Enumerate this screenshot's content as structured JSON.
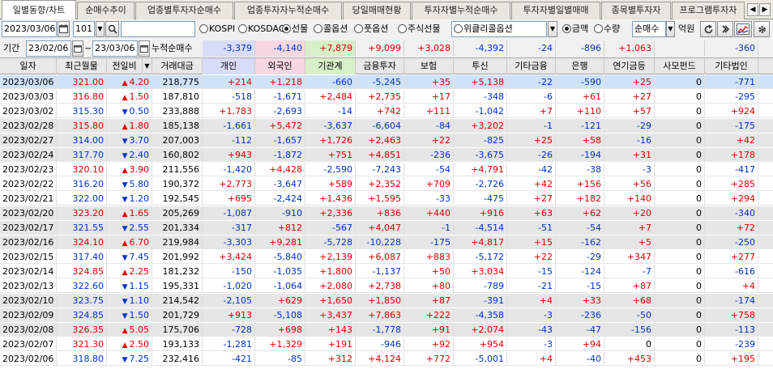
{
  "tabs": [
    "일별동향/차트",
    "순매수추이",
    "업종별투자자순매수",
    "업종투자자누적순매수",
    "당일매매현황",
    "투자자별누적순매수",
    "투자자별일별매매",
    "종목별투자자",
    "프로그램투자자"
  ],
  "nav": {
    "prev": "◀",
    "next": "▶"
  },
  "toolbar": {
    "date": "2023/03/06",
    "code": "101",
    "market_options": [
      "KOSPI",
      "KOSDAQ",
      "선물",
      "콜옵션",
      "풋옵션",
      "주식선물",
      "위클리콜옵션"
    ],
    "market_selected": "선물",
    "amount_options": [
      "금액",
      "수량"
    ],
    "amount_selected": "금액",
    "trade_type": "순매수",
    "unit": "억원"
  },
  "period": {
    "label": "기간",
    "from": "23/02/06",
    "tilde": "~",
    "to": "23/03/06",
    "cumulative_label": "누적순매수",
    "sums": [
      "-3,379",
      "-4,140",
      "+7,879",
      "+9,099",
      "+3,028",
      "-4,392",
      "-24",
      "-896",
      "+1,063",
      "",
      "-360"
    ]
  },
  "columns": [
    "일자",
    "최근월물",
    "전일비",
    "거래대금",
    "개인",
    "외국인",
    "기관계",
    "금융투자",
    "보험",
    "투신",
    "기타금융",
    "은행",
    "연기금등",
    "사모펀드",
    "기타법인"
  ],
  "rows": [
    [
      "2023/03/06",
      "321.00",
      "up",
      "4.20",
      "218,775",
      "+214",
      "+1,218",
      "-660",
      "-5,245",
      "+35",
      "+5,138",
      "-22",
      "-590",
      "+25",
      "0",
      "-771"
    ],
    [
      "2023/03/03",
      "316.80",
      "up",
      "1.50",
      "187,810",
      "-518",
      "-1,671",
      "+2,484",
      "+2,735",
      "+17",
      "-348",
      "-6",
      "+61",
      "+27",
      "0",
      "-295"
    ],
    [
      "2023/03/02",
      "315.30",
      "dn",
      "0.50",
      "233,888",
      "+1,783",
      "-2,693",
      "-14",
      "+742",
      "+111",
      "-1,042",
      "+7",
      "+110",
      "+57",
      "0",
      "+924"
    ],
    [
      "2023/02/28",
      "315.80",
      "up",
      "1.80",
      "185,138",
      "-1,661",
      "+5,472",
      "-3,637",
      "-6,604",
      "-84",
      "+3,202",
      "-1",
      "-121",
      "-29",
      "0",
      "-175"
    ],
    [
      "2023/02/27",
      "314.00",
      "dn",
      "3.70",
      "207,003",
      "-112",
      "-1,657",
      "+1,726",
      "+2,463",
      "+22",
      "-825",
      "+25",
      "+58",
      "-16",
      "0",
      "+42"
    ],
    [
      "2023/02/24",
      "317.70",
      "dn",
      "2.40",
      "160,802",
      "+943",
      "-1,872",
      "+751",
      "+4,851",
      "-236",
      "-3,675",
      "-26",
      "-194",
      "+31",
      "0",
      "+178"
    ],
    [
      "2023/02/23",
      "320.10",
      "up",
      "3.90",
      "211,556",
      "-1,420",
      "+4,428",
      "-2,590",
      "-7,243",
      "-54",
      "+4,791",
      "-42",
      "-38",
      "-3",
      "0",
      "-417"
    ],
    [
      "2023/02/22",
      "316.20",
      "dn",
      "5.80",
      "190,372",
      "+2,773",
      "-3,647",
      "+589",
      "+2,352",
      "+709",
      "-2,726",
      "+42",
      "+156",
      "+56",
      "0",
      "+285"
    ],
    [
      "2023/02/21",
      "322.00",
      "dn",
      "1.20",
      "192,545",
      "+695",
      "-2,424",
      "+1,436",
      "+1,595",
      "-33",
      "-475",
      "+27",
      "+182",
      "+140",
      "0",
      "+294"
    ],
    [
      "2023/02/20",
      "323.20",
      "up",
      "1.65",
      "205,269",
      "-1,087",
      "-910",
      "+2,336",
      "+836",
      "+440",
      "+916",
      "+63",
      "+62",
      "+20",
      "0",
      "-340"
    ],
    [
      "2023/02/17",
      "321.55",
      "dn",
      "2.55",
      "201,334",
      "-317",
      "+812",
      "-567",
      "+4,047",
      "-1",
      "-4,514",
      "-51",
      "-54",
      "+7",
      "0",
      "+72"
    ],
    [
      "2023/02/16",
      "324.10",
      "up",
      "6.70",
      "219,984",
      "-3,303",
      "+9,281",
      "-5,728",
      "-10,228",
      "-175",
      "+4,817",
      "+15",
      "-162",
      "+5",
      "0",
      "-250"
    ],
    [
      "2023/02/15",
      "317.40",
      "dn",
      "7.45",
      "201,992",
      "+3,424",
      "-5,840",
      "+2,139",
      "+6,087",
      "+883",
      "-5,172",
      "+22",
      "-29",
      "+347",
      "0",
      "+277"
    ],
    [
      "2023/02/14",
      "324.85",
      "up",
      "2.25",
      "181,232",
      "-150",
      "-1,035",
      "+1,800",
      "-1,137",
      "+50",
      "+3,034",
      "-15",
      "-124",
      "-7",
      "0",
      "-616"
    ],
    [
      "2023/02/13",
      "322.60",
      "dn",
      "1.15",
      "195,331",
      "-1,020",
      "-1,064",
      "+2,080",
      "+2,738",
      "+80",
      "-789",
      "-21",
      "-15",
      "+87",
      "0",
      "+4"
    ],
    [
      "2023/02/10",
      "323.75",
      "dn",
      "1.10",
      "214,542",
      "-2,105",
      "+629",
      "+1,650",
      "+1,850",
      "+87",
      "-391",
      "+4",
      "+33",
      "+68",
      "0",
      "-174"
    ],
    [
      "2023/02/09",
      "324.85",
      "dn",
      "1.50",
      "201,729",
      "+913",
      "-5,108",
      "+3,437",
      "+7,863",
      "+222",
      "-4,358",
      "-3",
      "-236",
      "-50",
      "0",
      "+758"
    ],
    [
      "2023/02/08",
      "326.35",
      "up",
      "5.05",
      "175,706",
      "-728",
      "+698",
      "+143",
      "-1,778",
      "+91",
      "+2,074",
      "-43",
      "-47",
      "-156",
      "0",
      "-113"
    ],
    [
      "2023/02/07",
      "321.30",
      "up",
      "2.50",
      "193,133",
      "-1,281",
      "+1,329",
      "+191",
      "-946",
      "+92",
      "+954",
      "-3",
      "+94",
      "0",
      "0",
      "-239"
    ],
    [
      "2023/02/06",
      "318.80",
      "dn",
      "7.25",
      "232,416",
      "-421",
      "-85",
      "+312",
      "+4,124",
      "+772",
      "-5,001",
      "+4",
      "-40",
      "+453",
      "0",
      "+195"
    ]
  ],
  "icons": [
    "calendar-icon",
    "search-icon",
    "refresh-icon",
    "chart-icon",
    "settings-icon"
  ]
}
